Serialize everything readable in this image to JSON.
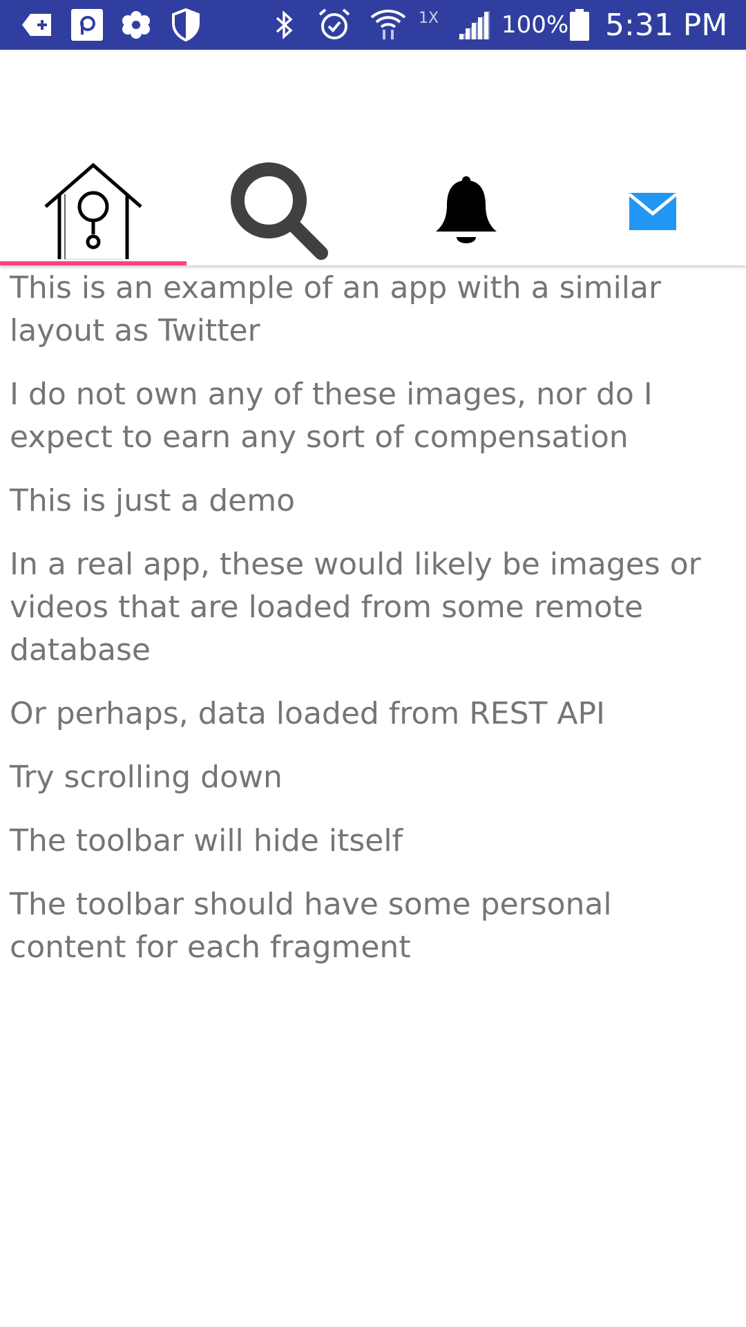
{
  "status_bar": {
    "network_type": "1X",
    "battery_percent": "100%",
    "time": "5:31 PM",
    "icons": [
      "add-box-icon",
      "app-p-icon",
      "flower-icon",
      "shield-icon",
      "bluetooth-icon",
      "alarm-icon",
      "wifi-icon",
      "signal-icon",
      "battery-icon"
    ]
  },
  "tabs": [
    {
      "name": "home",
      "icon": "birdhouse-icon",
      "selected": true
    },
    {
      "name": "search",
      "icon": "search-icon",
      "selected": false
    },
    {
      "name": "notifications",
      "icon": "bell-icon",
      "selected": false
    },
    {
      "name": "messages",
      "icon": "mail-icon",
      "selected": false
    }
  ],
  "colors": {
    "status_bar": "#303F9F",
    "tab_indicator": "#FF4081",
    "body_text": "#757575",
    "mail_icon": "#2196F3"
  },
  "content": {
    "paragraphs": [
      "This is an example of an app with a similar layout as Twitter",
      "I do not own any of these images, nor do I expect to earn any sort of compensation",
      "This is just a demo",
      "In a real app, these would likely be images or videos that are loaded from some remote database",
      "Or perhaps, data loaded from REST API",
      "Try scrolling down",
      "The toolbar will hide itself",
      "The toolbar should have some personal content for each fragment"
    ]
  }
}
